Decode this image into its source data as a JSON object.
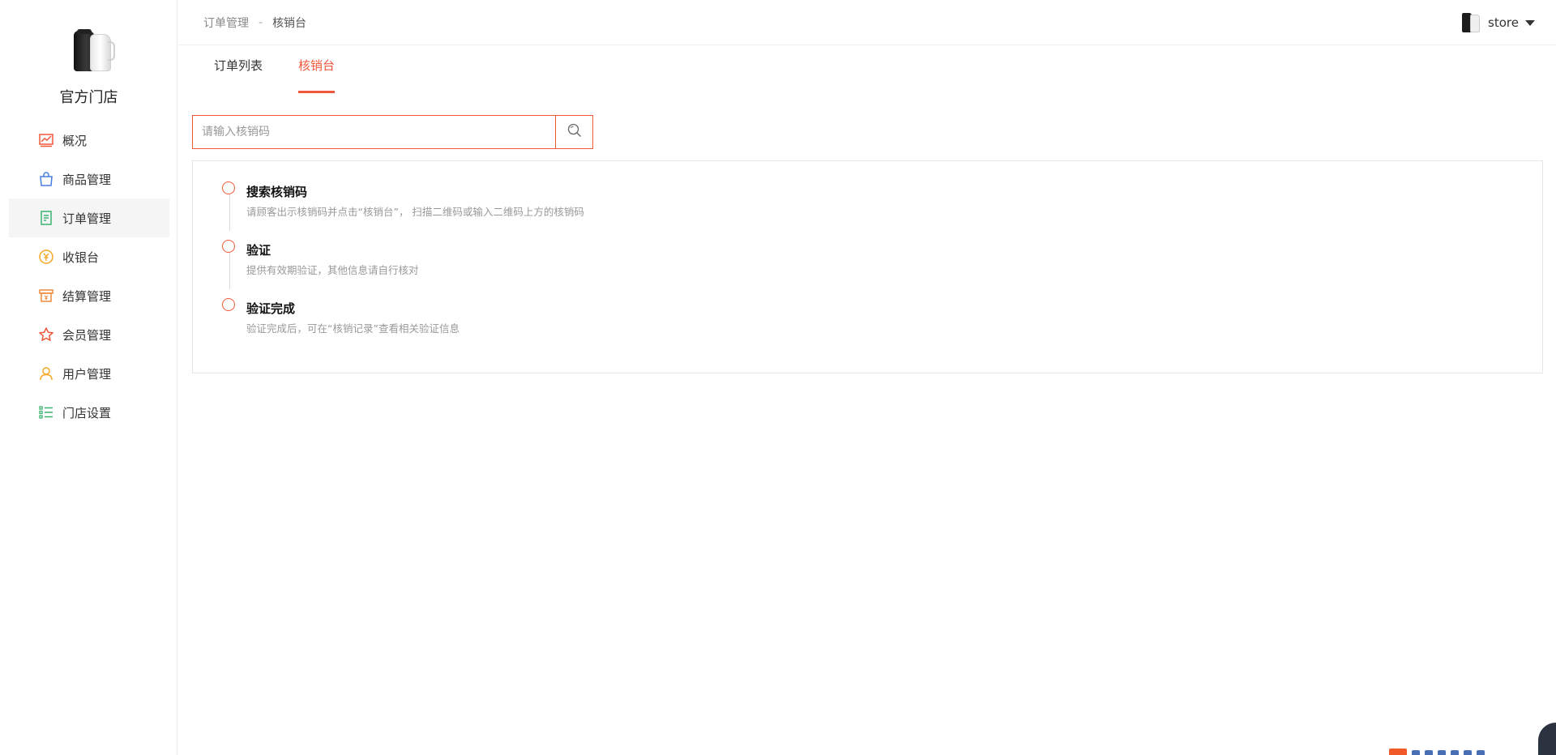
{
  "brand": {
    "name": "官方门店"
  },
  "sidebar": {
    "items": [
      {
        "label": "概况",
        "icon": "dashboard-chart-icon",
        "active": false
      },
      {
        "label": "商品管理",
        "icon": "shopping-bag-icon",
        "active": false
      },
      {
        "label": "订单管理",
        "icon": "order-document-icon",
        "active": true
      },
      {
        "label": "收银台",
        "icon": "yuan-coin-icon",
        "active": false
      },
      {
        "label": "结算管理",
        "icon": "settlement-register-icon",
        "active": false
      },
      {
        "label": "会员管理",
        "icon": "member-star-icon",
        "active": false
      },
      {
        "label": "用户管理",
        "icon": "user-person-icon",
        "active": false
      },
      {
        "label": "门店设置",
        "icon": "store-settings-list-icon",
        "active": false
      }
    ]
  },
  "header": {
    "breadcrumb": {
      "parent": "订单管理",
      "separator": "-",
      "current": "核销台"
    },
    "user": {
      "name": "store"
    }
  },
  "tabs": [
    {
      "label": "订单列表",
      "active": false
    },
    {
      "label": "核销台",
      "active": true
    }
  ],
  "search": {
    "placeholder": "请输入核销码",
    "value": ""
  },
  "steps": [
    {
      "title": "搜索核销码",
      "desc": "请顾客出示核销码并点击“核销台”， 扫描二维码或输入二维码上方的核销码"
    },
    {
      "title": "验证",
      "desc": "提供有效期验证，其他信息请自行核对"
    },
    {
      "title": "验证完成",
      "desc": "验证完成后，可在“核销记录”查看相关验证信息"
    }
  ],
  "colors": {
    "accent": "#f0583a",
    "active_bg": "#f5f5f5",
    "border": "#e6e6e6"
  }
}
